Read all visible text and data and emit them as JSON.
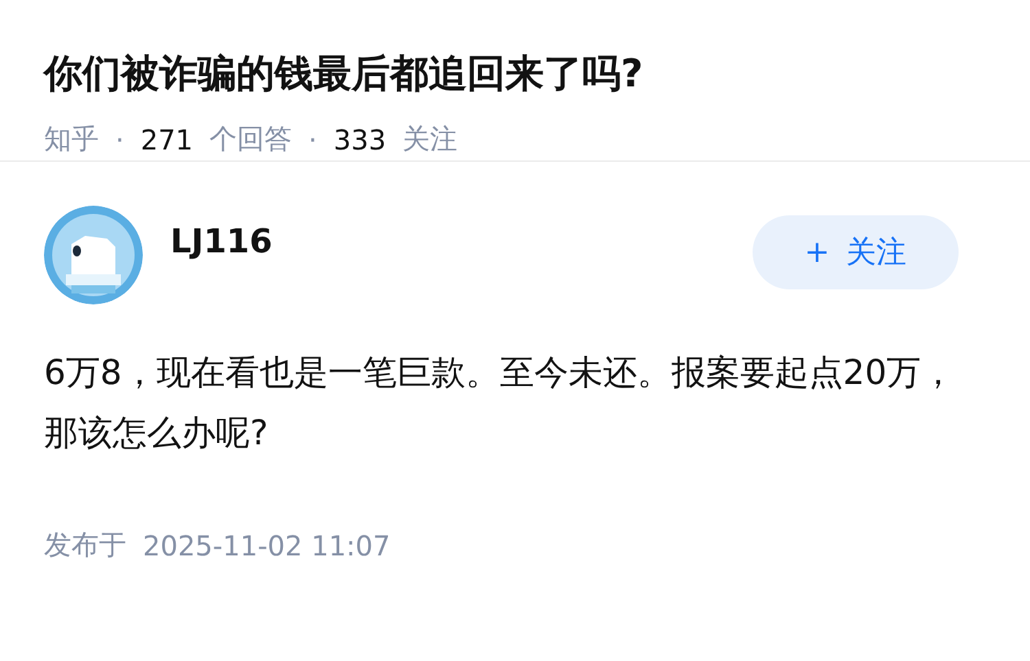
{
  "question": {
    "title": "你们被诈骗的钱最后都追回来了吗?",
    "source": "知乎",
    "separators": [
      "·",
      "·"
    ],
    "answer_count": "271",
    "answer_label": "个回答",
    "follower_count": "333",
    "follower_label": "关注"
  },
  "answer": {
    "author": "LJ116",
    "follow_button": {
      "icon": "+",
      "label": "关注"
    },
    "content": "6万8，现在看也是一笔巨款。至今未还。报案要起点20万，那该怎么办呢?",
    "published_label": "发布于",
    "published_time": "2025-11-02 11:07"
  }
}
